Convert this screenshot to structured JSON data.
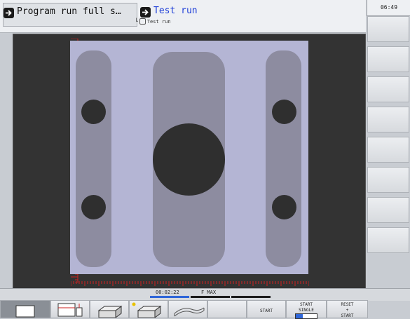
{
  "header": {
    "mode_primary": "Program run full s…",
    "mode_secondary": "Test run",
    "program_name": "Test run",
    "clock": "06:49"
  },
  "status": {
    "time": "00:02:22",
    "feed": "F MAX"
  },
  "softkeys": {
    "start": "START",
    "start_single_1": "START",
    "start_single_2": "SINGLE",
    "reset_1": "RESET",
    "reset_2": "+",
    "reset_3": "START"
  },
  "colors": {
    "accent": "#1f3fd8",
    "progress": "#2f66d8",
    "workpiece": "#b4b5d4",
    "pocket": "#8d8ca0",
    "hole": "#2f2f2f",
    "ruler": "#cc2222"
  },
  "icons": {
    "mode_arrow": "program-run-arrow-icon",
    "view_single": "single-view-icon",
    "view_split": "split-view-icon",
    "view_3d": "3d-block-icon",
    "view_3d_alt": "3d-block-alt-icon",
    "view_wire": "wireframe-icon"
  }
}
